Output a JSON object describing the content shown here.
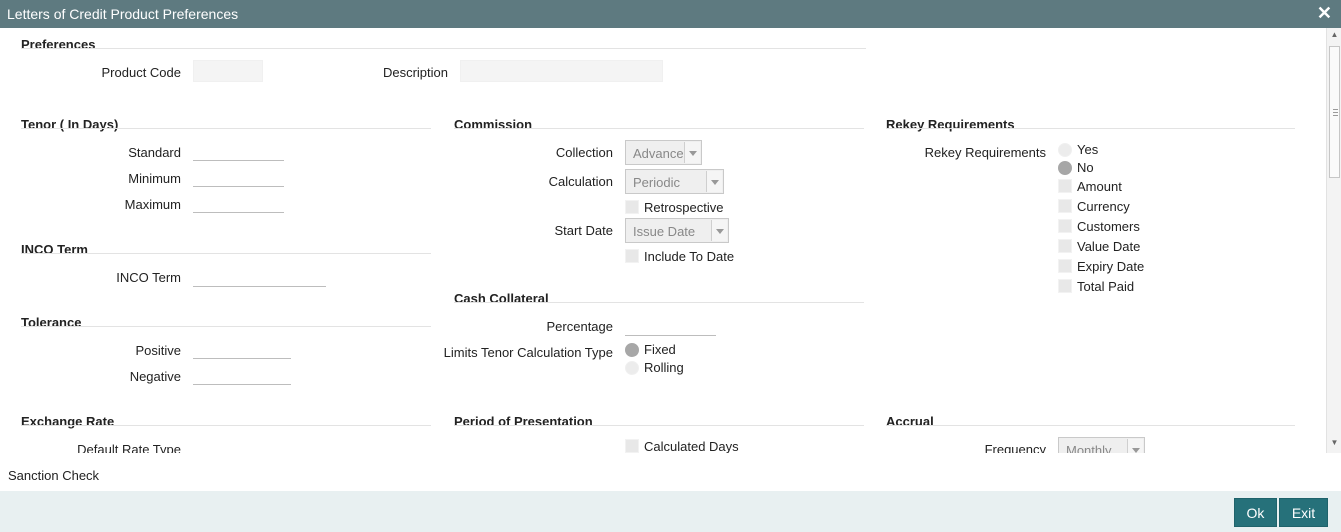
{
  "window": {
    "title": "Letters of Credit Product Preferences"
  },
  "preferences": {
    "heading": "Preferences",
    "product_code_label": "Product Code",
    "product_code_value": "",
    "description_label": "Description",
    "description_value": ""
  },
  "tenor": {
    "heading": "Tenor ( In Days)",
    "standard_label": "Standard",
    "minimum_label": "Minimum",
    "maximum_label": "Maximum"
  },
  "inco": {
    "heading": "INCO Term",
    "term_label": "INCO Term"
  },
  "tolerance": {
    "heading": "Tolerance",
    "positive_label": "Positive",
    "negative_label": "Negative"
  },
  "exchange_rate": {
    "heading": "Exchange Rate",
    "default_rate_type_label": "Default Rate Type"
  },
  "commission": {
    "heading": "Commission",
    "collection_label": "Collection",
    "collection_value": "Advance",
    "calculation_label": "Calculation",
    "calculation_value": "Periodic",
    "retrospective_label": "Retrospective",
    "start_date_label": "Start Date",
    "start_date_value": "Issue Date",
    "include_to_date_label": "Include To Date"
  },
  "cash_collateral": {
    "heading": "Cash Collateral",
    "percentage_label": "Percentage",
    "limits_tenor_label": "Limits Tenor Calculation Type",
    "fixed_label": "Fixed",
    "rolling_label": "Rolling",
    "selected": "Fixed"
  },
  "period_of_presentation": {
    "heading": "Period of Presentation",
    "calculated_days_label": "Calculated Days"
  },
  "rekey": {
    "heading": "Rekey Requirements",
    "label": "Rekey Requirements",
    "yes_label": "Yes",
    "no_label": "No",
    "selected": "No",
    "amount_label": "Amount",
    "currency_label": "Currency",
    "customers_label": "Customers",
    "value_date_label": "Value Date",
    "expiry_date_label": "Expiry Date",
    "total_paid_label": "Total Paid"
  },
  "accrual": {
    "heading": "Accrual",
    "frequency_label": "Frequency",
    "frequency_value": "Monthly"
  },
  "bottom": {
    "sanction_check": "Sanction Check",
    "ok_label": "Ok",
    "exit_label": "Exit"
  }
}
